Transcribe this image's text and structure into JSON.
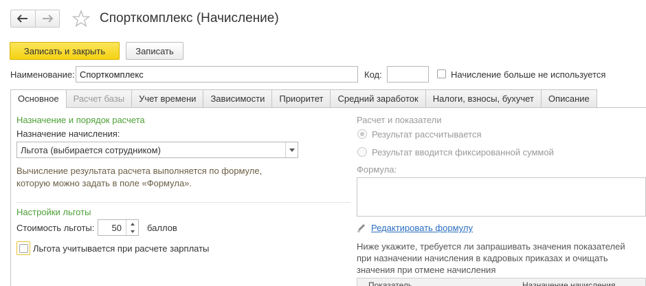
{
  "window": {
    "title": "Спорткомплекс (Начисление)"
  },
  "toolbar": {
    "save_close_label": "Записать и закрыть",
    "save_label": "Записать"
  },
  "header_fields": {
    "name_label": "Наименование:",
    "name_value": "Спорткомплекс",
    "code_label": "Код:",
    "code_value": "",
    "unused_label": "Начисление больше не используется"
  },
  "tabs": [
    {
      "label": "Основное",
      "state": "active"
    },
    {
      "label": "Расчет базы",
      "state": "disabled"
    },
    {
      "label": "Учет времени",
      "state": "normal"
    },
    {
      "label": "Зависимости",
      "state": "normal"
    },
    {
      "label": "Приоритет",
      "state": "normal"
    },
    {
      "label": "Средний заработок",
      "state": "normal"
    },
    {
      "label": "Налоги, взносы, бухучет",
      "state": "normal"
    },
    {
      "label": "Описание",
      "state": "normal"
    }
  ],
  "left": {
    "section_title": "Назначение и порядок расчета",
    "purpose_label": "Назначение начисления:",
    "purpose_value": "Льгота (выбирается сотрудником)",
    "note_line1": "Вычисление результата расчета выполняется по формуле,",
    "note_line2": "которую можно задать в поле «Формула».",
    "benefit_section_title": "Настройки льготы",
    "cost_label": "Стоимость льготы:",
    "cost_value": "50",
    "cost_unit": "баллов",
    "salary_checkbox_label": "Льгота учитывается при расчете зарплаты"
  },
  "right": {
    "section_title": "Расчет и показатели",
    "radio_calculated": "Результат рассчитывается",
    "radio_fixed": "Результат вводится фиксированной суммой",
    "formula_label": "Формула:",
    "formula_value": "",
    "edit_formula_link": "Редактировать формулу",
    "hint_line1": "Ниже укажите, требуется ли запрашивать значения показателей",
    "hint_line2": "при назначении начисления в кадровых приказах и очищать",
    "hint_line3": "значения при отмене начисления",
    "table_columns": [
      "Показатель",
      "Назначение начисления"
    ]
  },
  "colors": {
    "primary_button": "#f5d213",
    "section_green": "#4d9f36",
    "link_blue": "#2a6ebf"
  }
}
